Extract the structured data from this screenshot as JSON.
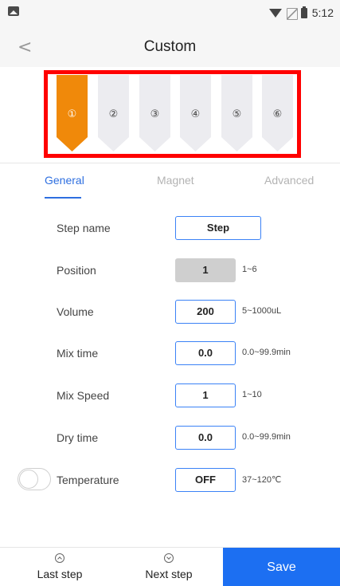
{
  "status_bar": {
    "time": "5:12",
    "icons": [
      "image-icon",
      "wifi-icon",
      "no-sim-icon",
      "battery-icon"
    ]
  },
  "header": {
    "title": "Custom",
    "back_icon": "chevron-left-icon"
  },
  "steps": [
    {
      "label": "①",
      "active": true
    },
    {
      "label": "②",
      "active": false
    },
    {
      "label": "③",
      "active": false
    },
    {
      "label": "④",
      "active": false
    },
    {
      "label": "⑤",
      "active": false
    },
    {
      "label": "⑥",
      "active": false
    }
  ],
  "tabs": [
    {
      "label": "General",
      "active": true
    },
    {
      "label": "Magnet",
      "active": false
    },
    {
      "label": "Advanced",
      "active": false
    }
  ],
  "form": {
    "step_name": {
      "label": "Step name",
      "value": "Step"
    },
    "position": {
      "label": "Position",
      "value": "1",
      "range": "1~6"
    },
    "volume": {
      "label": "Volume",
      "value": "200",
      "range": "5~1000uL"
    },
    "mix_time": {
      "label": "Mix time",
      "value": "0.0",
      "range": "0.0~99.9min"
    },
    "mix_speed": {
      "label": "Mix Speed",
      "value": "1",
      "range": "1~10"
    },
    "dry_time": {
      "label": "Dry time",
      "value": "0.0",
      "range": "0.0~99.9min"
    },
    "temperature": {
      "label": "Temperature",
      "value": "OFF",
      "range": "37~120℃",
      "enabled": false
    }
  },
  "bottom": {
    "last_step": "Last step",
    "next_step": "Next step",
    "save": "Save"
  },
  "colors": {
    "accent": "#2e6fe0",
    "save_bg": "#1c6ff2",
    "active_step": "#f0890a",
    "inactive_step": "#ececf0",
    "highlight": "#ff0000"
  }
}
